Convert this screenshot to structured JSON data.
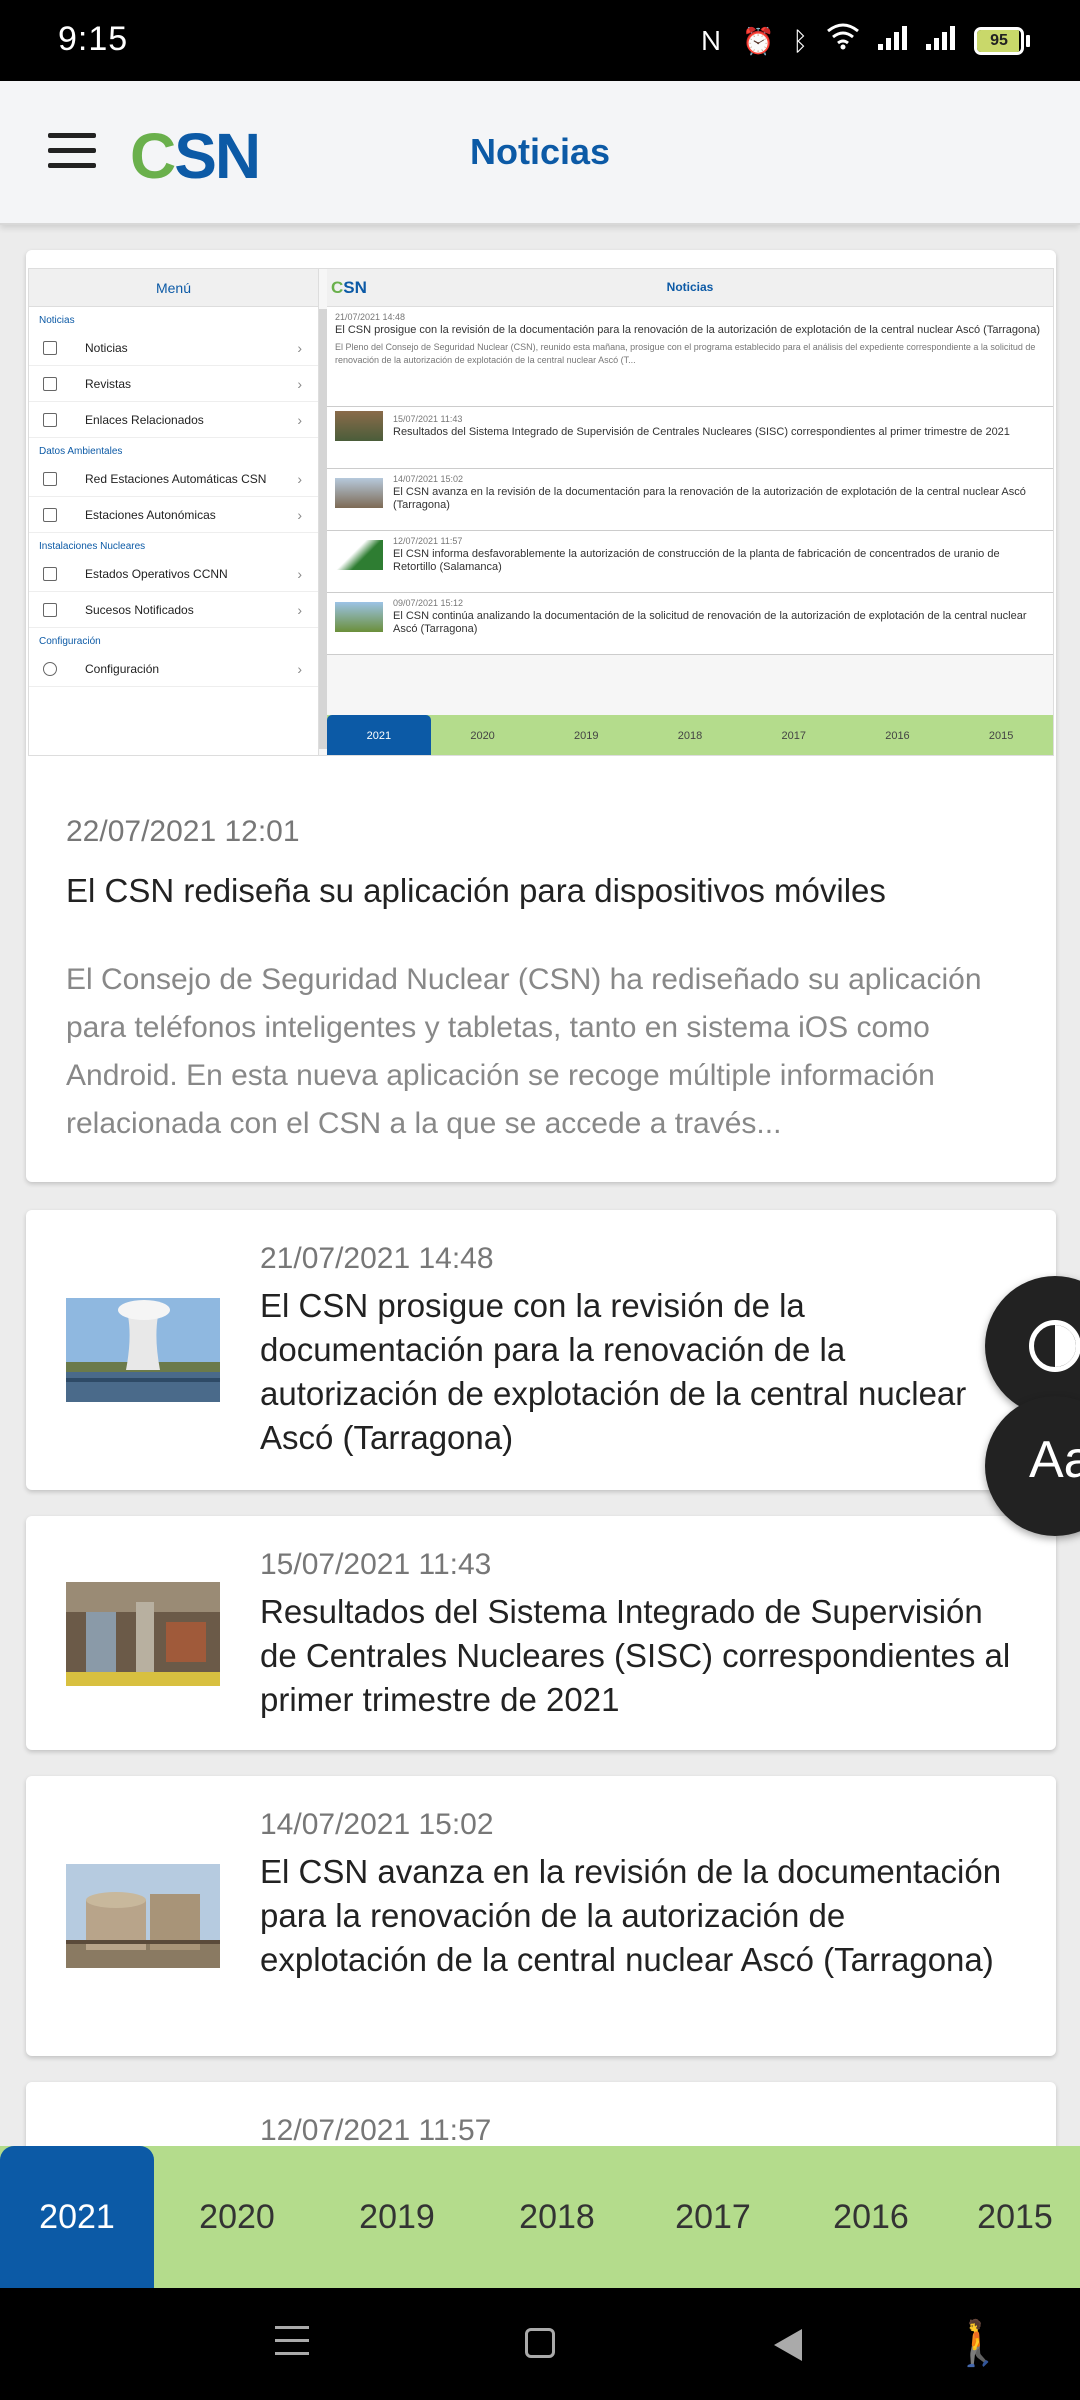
{
  "status_bar": {
    "time": "9:15",
    "icons": [
      "nfc-icon",
      "alarm-icon",
      "bluetooth-icon",
      "wifi-icon",
      "signal-icon",
      "signal-icon"
    ],
    "battery": "95",
    "battery_level": 0.95
  },
  "app_bar": {
    "logo_c": "C",
    "logo_sn": "SN",
    "title": "Noticias"
  },
  "colors": {
    "brand_blue": "#0c5aa6",
    "brand_green": "#6ab04c",
    "year_bar": "#b4dc8c"
  },
  "featured": {
    "preview": {
      "menu_title": "Menú",
      "bar_logo_c": "C",
      "bar_logo_sn": "SN",
      "bar_title": "Noticias",
      "sections": [
        {
          "title": "Noticias",
          "items": [
            "Noticias",
            "Revistas",
            "Enlaces Relacionados"
          ]
        },
        {
          "title": "Datos Ambientales",
          "items": [
            "Red Estaciones Automáticas CSN",
            "Estaciones Autonómicas"
          ]
        },
        {
          "title": "Instalaciones Nucleares",
          "items": [
            "Estados Operativos CCNN",
            "Sucesos Notificados"
          ]
        },
        {
          "title": "Configuración",
          "items": [
            "Configuración"
          ]
        }
      ],
      "news": [
        {
          "date": "21/07/2021 14:48",
          "title": "El CSN prosigue con la revisión de la documentación para la renovación de la autorización de explotación de la central nuclear Ascó (Tarragona)",
          "summary": "El Pleno del Consejo de Seguridad Nuclear (CSN), reunido esta mañana, prosigue con el programa establecido para el análisis del expediente correspondiente a la solicitud de renovación de la autorización de explotación de la central nuclear Ascó (T..."
        },
        {
          "date": "15/07/2021 11:43",
          "title": "Resultados del Sistema Integrado de Supervisión de Centrales Nucleares (SISC) correspondientes al primer trimestre de 2021"
        },
        {
          "date": "14/07/2021 15:02",
          "title": "El CSN avanza en la revisión de la documentación para la renovación de la autorización de explotación de la central nuclear Ascó (Tarragona)"
        },
        {
          "date": "12/07/2021 11:57",
          "title": "El CSN informa desfavorablemente la autorización de construcción de la planta de fabricación de concentrados de uranio de Retortillo (Salamanca)"
        },
        {
          "date": "09/07/2021 15:12",
          "title": "El CSN continúa analizando la documentación de la solicitud de renovación de la autorización de explotación de la central nuclear Ascó (Tarragona)"
        }
      ],
      "years": [
        "2021",
        "2020",
        "2019",
        "2018",
        "2017",
        "2016",
        "2015"
      ]
    },
    "date": "22/07/2021 12:01",
    "title": "El CSN rediseña su aplicación para dispositivos móviles",
    "summary": "El Consejo de Seguridad Nuclear (CSN) ha rediseñado su aplicación para teléfonos inteligentes y tabletas, tanto en sistema iOS como Android. En esta nueva aplicación se recoge múltiple información relacionada con el CSN a la que se accede a través..."
  },
  "news": [
    {
      "date": "21/07/2021 14:48",
      "title": "El CSN prosigue con la revisión de la documentación para la renovación de la autorización de explotación de la central nuclear Ascó (Tarragona)"
    },
    {
      "date": "15/07/2021 11:43",
      "title": "Resultados del Sistema Integrado de Supervisión de Centrales Nucleares (SISC) correspondientes al primer trimestre de 2021"
    },
    {
      "date": "14/07/2021 15:02",
      "title": "El CSN avanza en la revisión de la documentación para la renovación de la autorización de explotación de la central nuclear Ascó (Tarragona)"
    },
    {
      "date": "12/07/2021 11:57",
      "title": ""
    }
  ],
  "accessibility": {
    "contrast_icon": "contrast-icon",
    "text_size_label": "Aa"
  },
  "years": {
    "active": "2021",
    "tabs": [
      "2021",
      "2020",
      "2019",
      "2018",
      "2017",
      "2016",
      "2015"
    ]
  },
  "nav_bar": {
    "icons": [
      "recents-icon",
      "home-icon",
      "back-icon",
      "accessibility-icon"
    ]
  }
}
